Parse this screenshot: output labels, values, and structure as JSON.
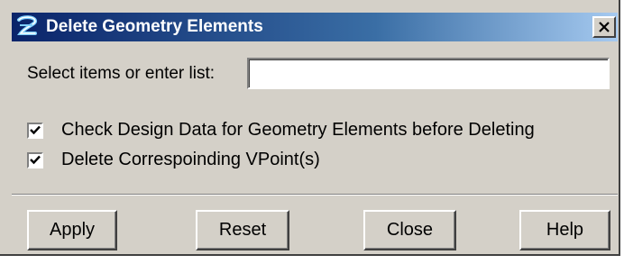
{
  "window": {
    "title": "Delete Geometry Elements",
    "icon": "app-logo-icon",
    "close_icon": "close-icon"
  },
  "select": {
    "label": "Select items or enter list:",
    "value": ""
  },
  "checkboxes": [
    {
      "label": "Check Design Data for Geometry Elements before Deleting",
      "checked": true
    },
    {
      "label": "Delete Correspoinding VPoint(s)",
      "checked": true
    }
  ],
  "buttons": {
    "apply": "Apply",
    "reset": "Reset",
    "close": "Close",
    "help": "Help"
  },
  "colors": {
    "title_gradient_start": "#0a246a",
    "title_gradient_end": "#a6caf0",
    "face": "#d4d0c8"
  }
}
